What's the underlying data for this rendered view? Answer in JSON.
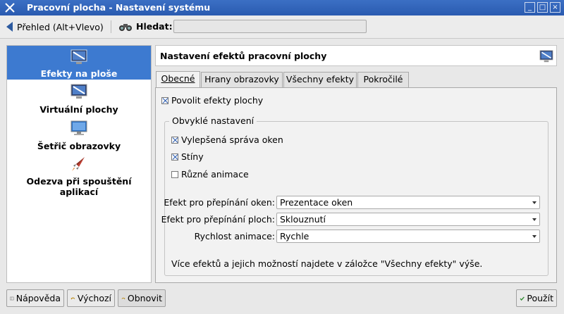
{
  "window": {
    "title": "Pracovní plocha - Nastavení systému",
    "controls": [
      "_",
      "□",
      "×"
    ]
  },
  "toolbar": {
    "back_label": "Přehled (Alt+Vlevo)",
    "search_label": "Hledat:",
    "search_value": ""
  },
  "sidebar": {
    "items": [
      {
        "label": "Efekty na ploše",
        "icon": "desktop-effects-icon",
        "active": true
      },
      {
        "label": "Virtuální plochy",
        "icon": "virtual-desktops-icon",
        "active": false
      },
      {
        "label": "Šetřič obrazovky",
        "icon": "screensaver-icon",
        "active": false
      },
      {
        "label": "Odezva při spouštění aplikací",
        "icon": "rocket-icon",
        "active": false
      }
    ]
  },
  "header": {
    "title": "Nastavení efektů pracovní plochy"
  },
  "tabs": [
    {
      "label": "Obecné",
      "active": true
    },
    {
      "label": "Hrany obrazovky",
      "active": false
    },
    {
      "label": "Všechny efekty",
      "active": false
    },
    {
      "label": "Pokročilé",
      "active": false
    }
  ],
  "general": {
    "enable_effects": {
      "label": "Povolit efekty plochy",
      "checked": true
    },
    "group_title": "Obvyklé nastavení",
    "options": [
      {
        "label": "Vylepšená správa oken",
        "checked": true
      },
      {
        "label": "Stíny",
        "checked": true
      },
      {
        "label": "Různé animace",
        "checked": false
      }
    ],
    "fields": [
      {
        "label": "Efekt pro přepínání oken:",
        "value": "Prezentace oken"
      },
      {
        "label": "Efekt pro přepínání ploch:",
        "value": "Sklouznutí"
      },
      {
        "label": "Rychlost animace:",
        "value": "Rychle"
      }
    ],
    "note": "Více efektů a jejich možností najdete v záložce \"Všechny efekty\" výše."
  },
  "buttons": {
    "help": "Nápověda",
    "defaults": "Výchozí",
    "reset": "Obnovit",
    "apply": "Použít"
  },
  "colors": {
    "titlebar": "#2a5bb0",
    "selection": "#3d7ad0"
  }
}
